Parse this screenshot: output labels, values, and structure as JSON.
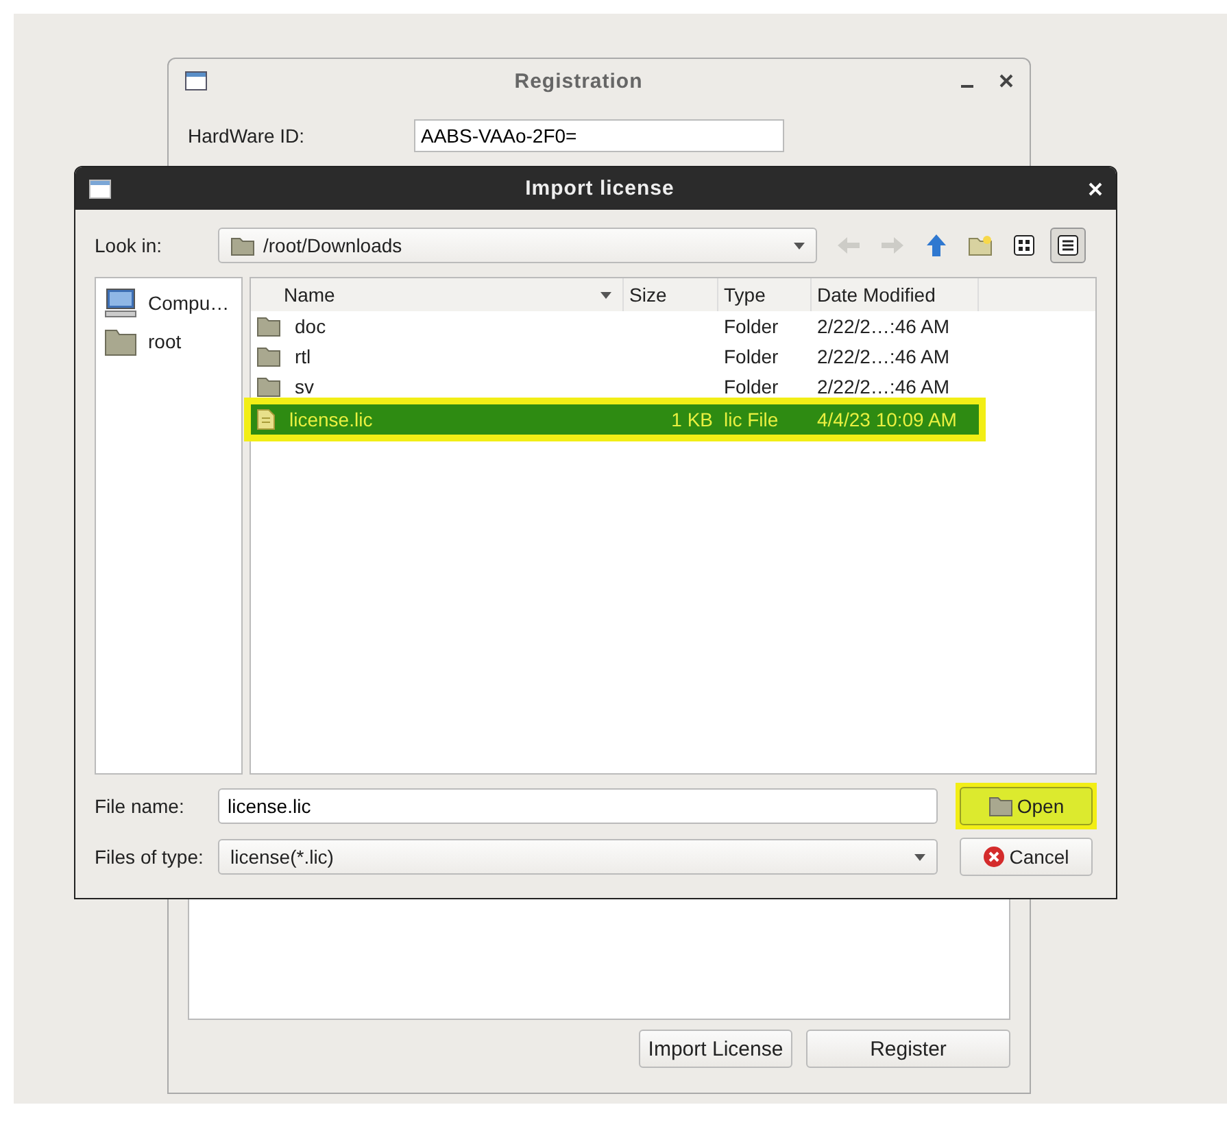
{
  "registration": {
    "title": "Registration",
    "hardware_id_label": "HardWare ID:",
    "hardware_id": "AABS-VAAo-2F0=",
    "buttons": [
      {
        "label": "Import License"
      },
      {
        "label": "Register"
      }
    ]
  },
  "dialog": {
    "title": "Import license",
    "look_in_label": "Look in:",
    "look_in": "/root/Downloads",
    "tool_buttons": [
      {
        "kind": "back",
        "disabled": true,
        "selected": false
      },
      {
        "kind": "forward",
        "disabled": true,
        "selected": false
      },
      {
        "kind": "up",
        "disabled": false,
        "selected": false
      },
      {
        "kind": "new-folder",
        "disabled": false,
        "selected": false
      },
      {
        "kind": "icon-view",
        "disabled": false,
        "selected": false
      },
      {
        "kind": "detail-view",
        "disabled": false,
        "selected": true
      }
    ],
    "places": [
      {
        "label": "Compu…",
        "kind": "computer"
      },
      {
        "label": "root",
        "kind": "folder"
      }
    ],
    "columns": [
      {
        "label": "Name",
        "sorted": true
      },
      {
        "label": "Size",
        "sorted": false
      },
      {
        "label": "Type",
        "sorted": false
      },
      {
        "label": "Date Modified",
        "sorted": false
      }
    ],
    "files": [
      {
        "name": "doc",
        "kind": "folder",
        "type": "Folder",
        "date": "2/22/2…:46 AM",
        "selected": false,
        "highlighted": false
      },
      {
        "name": "rtl",
        "kind": "folder",
        "type": "Folder",
        "date": "2/22/2…:46 AM",
        "selected": false,
        "highlighted": false
      },
      {
        "name": "sv",
        "kind": "folder",
        "type": "Folder",
        "date": "2/22/2…:46 AM",
        "selected": false,
        "highlighted": false
      },
      {
        "name": "license.lic",
        "kind": "file",
        "size": "1 KB",
        "type": "lic File",
        "date": "4/4/23 10:09 AM",
        "selected": true,
        "highlighted": true
      }
    ],
    "file_name_label": "File name:",
    "file_name": "license.lic",
    "file_type_label": "Files of type:",
    "file_type": "license(*.lic)",
    "buttons": [
      {
        "label": "Open",
        "kind": "open",
        "highlighted": true
      },
      {
        "label": "Cancel",
        "kind": "cancel",
        "highlighted": false
      }
    ]
  }
}
